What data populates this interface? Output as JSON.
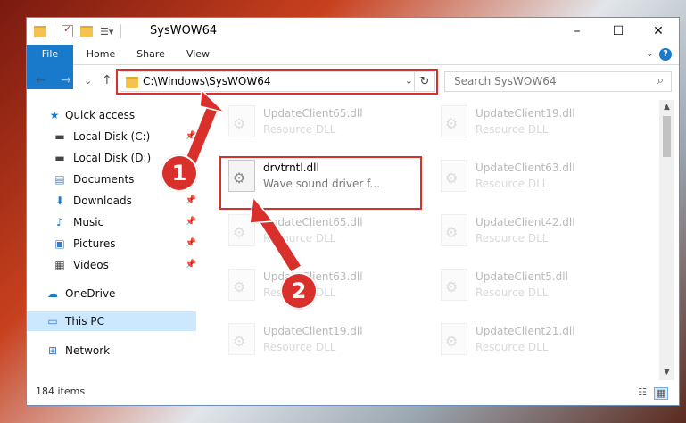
{
  "window": {
    "title": "SysWOW64",
    "minimize": "–",
    "maximize": "☐",
    "close": "✕"
  },
  "ribbon": {
    "tabs": [
      "File",
      "Home",
      "Share",
      "View"
    ],
    "help": "?",
    "collapse": "⌄"
  },
  "nav": {
    "back": "←",
    "forward": "→",
    "recent": "⌄",
    "up": "↑",
    "address": "C:\\Windows\\SysWOW64",
    "address_dropdown": "⌄",
    "refresh": "↻",
    "search_placeholder": "Search SysWOW64"
  },
  "navpane": {
    "items": [
      {
        "label": "Quick access",
        "icon": "star-icon",
        "glyph": "★",
        "color": "#1979ca",
        "pin": ""
      },
      {
        "label": "Local Disk (C:)",
        "icon": "drive-icon",
        "glyph": "▬",
        "color": "#444",
        "pin": "📌"
      },
      {
        "label": "Local Disk (D:)",
        "icon": "drive-icon",
        "glyph": "▬",
        "color": "#444",
        "pin": "📌"
      },
      {
        "label": "Documents",
        "icon": "documents-icon",
        "glyph": "▤",
        "color": "#5b7fa8",
        "pin": "📌"
      },
      {
        "label": "Downloads",
        "icon": "downloads-icon",
        "glyph": "⬇",
        "color": "#1979ca",
        "pin": "📌"
      },
      {
        "label": "Music",
        "icon": "music-icon",
        "glyph": "♪",
        "color": "#1979ca",
        "pin": "📌"
      },
      {
        "label": "Pictures",
        "icon": "pictures-icon",
        "glyph": "▣",
        "color": "#3a7bc8",
        "pin": "📌"
      },
      {
        "label": "Videos",
        "icon": "videos-icon",
        "glyph": "▦",
        "color": "#444",
        "pin": "📌"
      },
      {
        "label": "OneDrive",
        "icon": "onedrive-icon",
        "glyph": "☁",
        "color": "#1979ca",
        "pin": ""
      },
      {
        "label": "This PC",
        "icon": "this-pc-icon",
        "glyph": "▭",
        "color": "#3a7bc8",
        "pin": ""
      },
      {
        "label": "Network",
        "icon": "network-icon",
        "glyph": "⊞",
        "color": "#3a7bc8",
        "pin": ""
      }
    ]
  },
  "files": {
    "left": [
      {
        "name": "UpdateClient65.dll",
        "desc": "Resource DLL"
      },
      {
        "name": "drvtrntl.dll",
        "desc": "Wave sound driver f..."
      },
      {
        "name": "UpdateClient65.dll",
        "desc": "Resource DLL"
      },
      {
        "name": "UpdateClient63.dll",
        "desc": "Resource DLL"
      },
      {
        "name": "UpdateClient19.dll",
        "desc": "Resource DLL"
      }
    ],
    "right": [
      {
        "name": "UpdateClient19.dll",
        "desc": "Resource DLL"
      },
      {
        "name": "UpdateClient63.dll",
        "desc": "Resource DLL"
      },
      {
        "name": "UpdateClient42.dll",
        "desc": "Resource DLL"
      },
      {
        "name": "UpdateClient5.dll",
        "desc": "Resource DLL"
      },
      {
        "name": "UpdateClient21.dll",
        "desc": "Resource DLL"
      }
    ]
  },
  "status": {
    "items": "184 items",
    "details_view": "☷",
    "tiles_view": "▦"
  },
  "annotations": {
    "step1": "1",
    "step2": "2",
    "color": "#d9302c"
  },
  "colors": {
    "accent": "#1979ca",
    "selected": "#cce8ff"
  }
}
